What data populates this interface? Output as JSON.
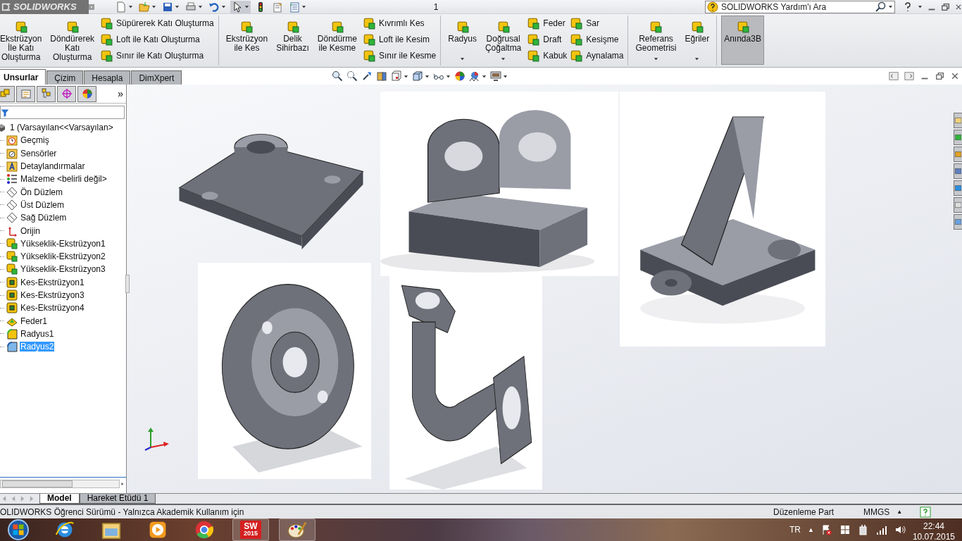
{
  "app": {
    "logo": "SOLIDWORKS",
    "document_title": "1",
    "help_search": {
      "placeholder": "SOLIDWORKS Yardım'ı Ara"
    }
  },
  "ribbon": {
    "groups": [
      {
        "items": [
          {
            "kind": "large",
            "label": "Ekstrüzyon\nİle Katı\nOluşturma",
            "dropdown": false,
            "selected": false
          },
          {
            "kind": "large",
            "label": "Döndürerek\nKatı\nOluşturma",
            "dropdown": false,
            "selected": false
          },
          {
            "kind": "stack",
            "entries": [
              "Süpürerek Katı Oluşturma",
              "Loft ile Katı Oluşturma",
              "Sınır ile Katı Oluşturma"
            ]
          }
        ]
      },
      {
        "items": [
          {
            "kind": "large",
            "label": "Ekstrüzyon\nile Kes",
            "dropdown": false,
            "selected": false
          },
          {
            "kind": "large",
            "label": "Delik\nSihirbazı",
            "dropdown": false,
            "selected": false
          },
          {
            "kind": "large",
            "label": "Döndürme\nile Kesme",
            "dropdown": false,
            "selected": false
          },
          {
            "kind": "stack",
            "entries": [
              "Kıvrımlı Kes",
              "Loft ile Kesim",
              "Sınır ile Kesme"
            ]
          }
        ]
      },
      {
        "items": [
          {
            "kind": "large",
            "label": "Radyus",
            "dropdown": true,
            "selected": false
          },
          {
            "kind": "large",
            "label": "Doğrusal\nÇoğaltma",
            "dropdown": true,
            "selected": false
          },
          {
            "kind": "stack",
            "entries": [
              "Feder",
              "Draft",
              "Kabuk"
            ]
          },
          {
            "kind": "stack",
            "entries": [
              "Sar",
              "Kesişme",
              "Aynalama"
            ]
          }
        ]
      },
      {
        "items": [
          {
            "kind": "large",
            "label": "Referans\nGeometrisi",
            "dropdown": true,
            "selected": false
          },
          {
            "kind": "large",
            "label": "Eğriler",
            "dropdown": true,
            "selected": false
          }
        ]
      },
      {
        "items": [
          {
            "kind": "large",
            "label": "Anında3B",
            "dropdown": false,
            "selected": true
          }
        ]
      }
    ]
  },
  "command_tabs": [
    {
      "label": "Unsurlar",
      "selected": true
    },
    {
      "label": "Çizim",
      "selected": false
    },
    {
      "label": "Hesapla",
      "selected": false
    },
    {
      "label": "DimXpert",
      "selected": false
    }
  ],
  "feature_tree": {
    "more": "»",
    "root": {
      "label": "1  (Varsayılan<<Varsayılan>",
      "kind": "part",
      "selected": false,
      "children": [
        {
          "label": "Geçmiş",
          "kind": "history",
          "selected": false
        },
        {
          "label": "Sensörler",
          "kind": "sensors",
          "selected": false
        },
        {
          "label": "Detaylandırmalar",
          "kind": "annotations",
          "selected": false
        },
        {
          "label": "Malzeme <belirli değil>",
          "kind": "material",
          "selected": false
        },
        {
          "label": "Ön Düzlem",
          "kind": "plane",
          "selected": false
        },
        {
          "label": "Üst Düzlem",
          "kind": "plane",
          "selected": false
        },
        {
          "label": "Sağ Düzlem",
          "kind": "plane",
          "selected": false
        },
        {
          "label": "Orijin",
          "kind": "origin",
          "selected": false
        },
        {
          "label": "Yükseklik-Ekstrüzyon1",
          "kind": "extrude",
          "selected": false
        },
        {
          "label": "Yükseklik-Ekstrüzyon2",
          "kind": "extrude",
          "selected": false
        },
        {
          "label": "Yükseklik-Ekstrüzyon3",
          "kind": "extrude",
          "selected": false
        },
        {
          "label": "Kes-Ekstrüzyon1",
          "kind": "cut",
          "selected": false
        },
        {
          "label": "Kes-Ekstrüzyon3",
          "kind": "cut",
          "selected": false
        },
        {
          "label": "Kes-Ekstrüzyon4",
          "kind": "cut",
          "selected": false
        },
        {
          "label": "Feder1",
          "kind": "spring",
          "selected": false
        },
        {
          "label": "Radyus1",
          "kind": "fillet",
          "selected": false
        },
        {
          "label": "Radyus2",
          "kind": "fillet",
          "selected": true
        }
      ]
    }
  },
  "bottom_tabs": [
    {
      "label": "Model",
      "selected": true
    },
    {
      "label": "Hareket Etüdü 1",
      "selected": false
    }
  ],
  "status_bar": {
    "message": "OLIDWORKS Öğrenci Sürümü - Yalnızca Akademik Kullanım için",
    "mode": "Düzenleme Part",
    "units": "MMGS",
    "units_caret": "▲"
  },
  "taskbar": {
    "apps": [
      {
        "kind": "ie",
        "running": false
      },
      {
        "kind": "explorer",
        "running": false
      },
      {
        "kind": "media",
        "running": false
      },
      {
        "kind": "chrome",
        "running": false
      },
      {
        "kind": "solidworks",
        "running": true,
        "logo": "SW",
        "version": "2015"
      },
      {
        "kind": "paint",
        "running": true
      }
    ],
    "language": "TR",
    "tray_expand": "▲",
    "time": "22:44",
    "date": "10.07.2015"
  }
}
